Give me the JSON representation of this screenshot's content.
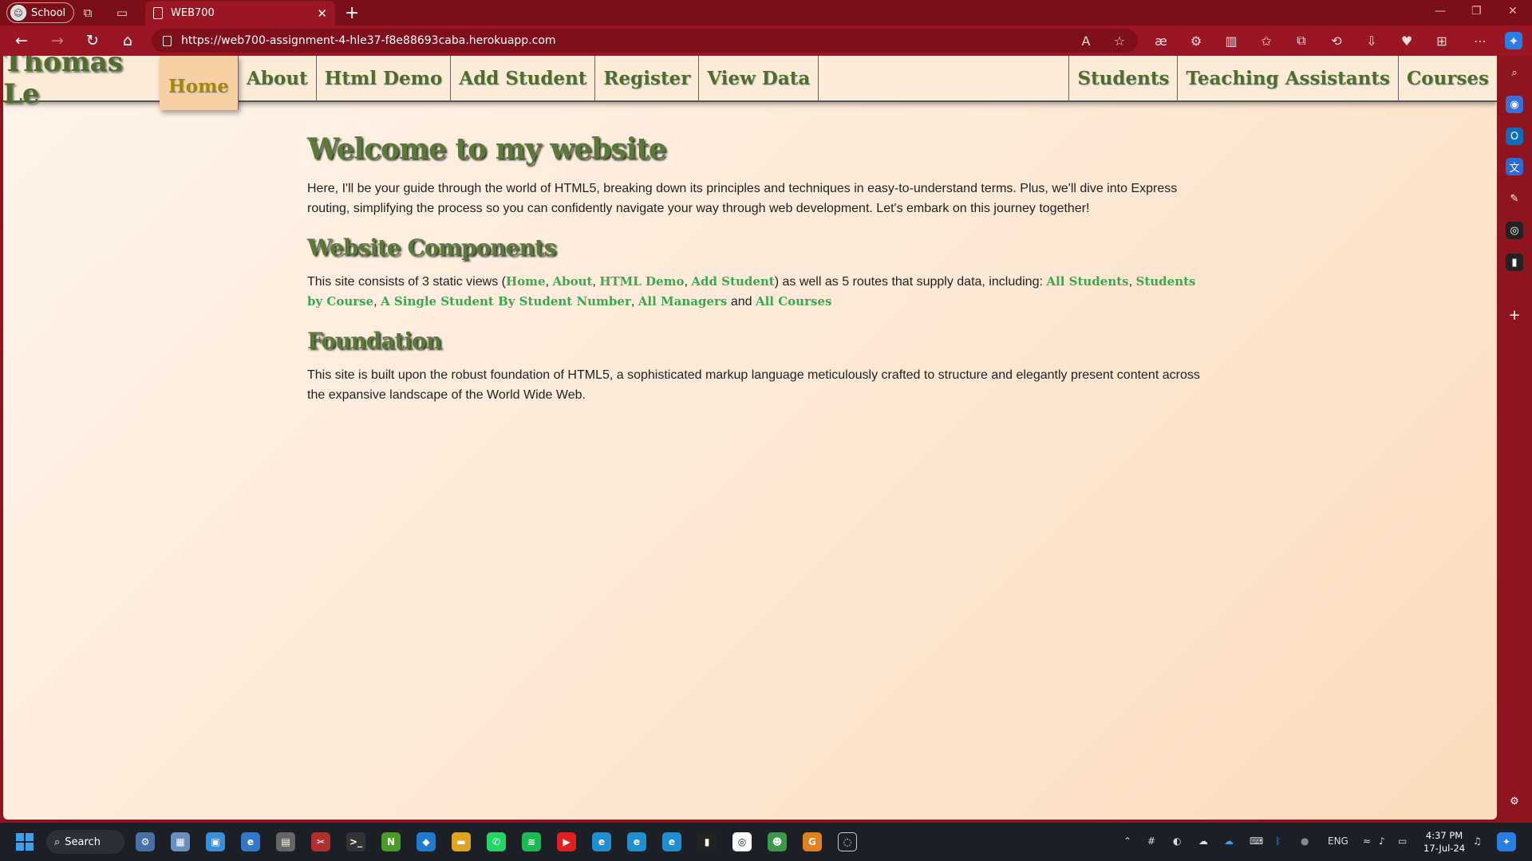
{
  "browser": {
    "profile_label": "School",
    "tab_title": "WEB700",
    "url": "https://web700-assignment-4-hle37-f8e88693caba.herokuapp.com"
  },
  "site": {
    "brand": "Thomas Le",
    "nav_left": [
      "Home",
      "About",
      "Html Demo",
      "Add Student",
      "Register",
      "View Data"
    ],
    "nav_right": [
      "Students",
      "Teaching Assistants",
      "Courses"
    ],
    "active_nav": "Home"
  },
  "content": {
    "welcome_heading": "Welcome to my website",
    "welcome_text": "Here, I'll be your guide through the world of HTML5, breaking down its principles and techniques in easy-to-understand terms. Plus, we'll dive into Express routing, simplifying the process so you can confidently navigate your way through web development. Let's embark on this journey together!",
    "components_heading": "Website Components",
    "components_intro": "This site consists of 3 static views (",
    "views": [
      "Home",
      "About",
      "HTML Demo",
      "Add Student"
    ],
    "components_mid": ") as well as 5 routes that supply data, including: ",
    "routes": [
      "All Students",
      "Students by Course",
      "A Single Student By Student Number",
      "All Managers",
      "All Courses"
    ],
    "and_word": "and",
    "foundation_heading": "Foundation",
    "foundation_text": "This site is built upon the robust foundation of HTML5, a sophisticated markup language meticulously crafted to structure and elegantly present content across the expansive landscape of the World Wide Web."
  },
  "taskbar": {
    "search_label": "Search",
    "language": "ENG",
    "time": "4:37 PM",
    "date": "17-Jul-24"
  },
  "colors": {
    "browser_frame": "#9b1624",
    "nav_bg": "#fbebd7",
    "heading_green": "#5a7a38",
    "link_green": "#3aa84e",
    "active_nav_bg": "#f7cfa2"
  }
}
